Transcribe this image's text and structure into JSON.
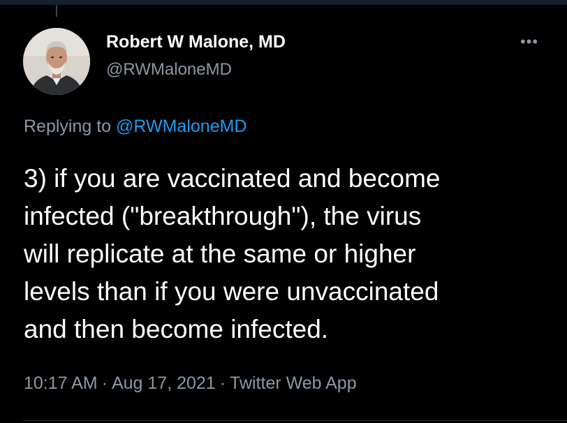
{
  "tweet": {
    "author": {
      "display_name": "Robert W Malone, MD",
      "handle": "@RWMaloneMD",
      "avatar_icon": "profile-photo"
    },
    "more_icon": "ellipsis-icon",
    "more_label": "•••",
    "replying": {
      "prefix": "Replying to ",
      "mention": "@RWMaloneMD"
    },
    "text_lines": [
      "3) if you are vaccinated and become",
      "infected (\"breakthrough\"), the virus",
      "will replicate at the same or higher",
      "levels than if you were unvaccinated",
      "and then become infected."
    ],
    "meta": {
      "time": "10:17 AM",
      "separator": "·",
      "date": "Aug 17, 2021",
      "source": "Twitter Web App"
    }
  },
  "colors": {
    "background": "#000000",
    "primary_text": "#ffffff",
    "secondary_text": "#8b98a5",
    "link": "#1d9bf0"
  }
}
